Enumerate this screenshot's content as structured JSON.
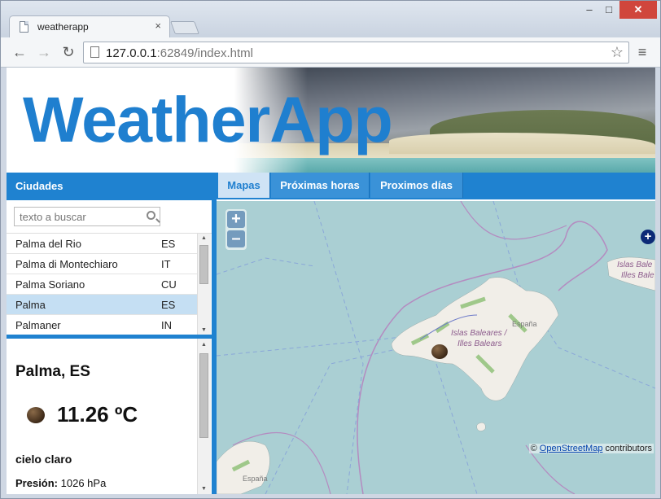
{
  "browser": {
    "tab_title": "weatherapp",
    "tab_close": "×",
    "url_host": "127.0.0.1",
    "url_rest": ":62849/index.html",
    "window_min": "–",
    "window_max": "□",
    "window_close": "✕"
  },
  "header": {
    "logo": "WeatherApp"
  },
  "sidebar": {
    "title": "Ciudades",
    "search_placeholder": "texto a buscar",
    "cities": [
      {
        "name": "Palma del Rio",
        "cc": "ES"
      },
      {
        "name": "Palma di Montechiaro",
        "cc": "IT"
      },
      {
        "name": "Palma Soriano",
        "cc": "CU"
      },
      {
        "name": "Palma",
        "cc": "ES",
        "selected": true
      },
      {
        "name": "Palmaner",
        "cc": "IN"
      }
    ]
  },
  "weather": {
    "title": "Palma, ES",
    "temperature": "11.26 ºC",
    "description": "cielo claro",
    "pressure_label": "Presión:",
    "pressure_value": "1026 hPa"
  },
  "map_tabs": [
    "Mapas",
    "Próximas horas",
    "Proximos días"
  ],
  "map": {
    "zoom_in": "+",
    "zoom_out": "–",
    "label_islands_1": "Islas Baleares /",
    "label_islands_2": "Illes Balears",
    "label_espana": "España",
    "label_espana_2": "España",
    "label_menorca_1": "Islas Bale",
    "label_menorca_2": "Illes Bale",
    "attribution_prefix": "©",
    "attribution_link": "OpenStreetMap",
    "attribution_suffix": "contributors",
    "layer_switch": "+"
  },
  "colors": {
    "brand": "#1f82d0",
    "selected_row": "#c5dff3",
    "sea": "#aacfd3",
    "land": "#f1eee8"
  }
}
